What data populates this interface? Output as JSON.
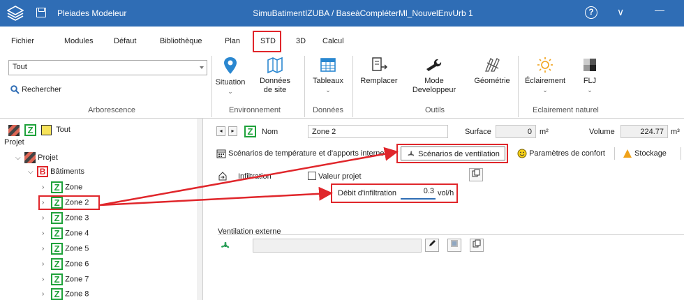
{
  "titlebar": {
    "app_name": "Pleiades Modeleur",
    "document": "SimuBatimentIZUBA / BaseàCompléterMl_NouvelEnvUrb 1",
    "help_symbol": "?",
    "chevron_symbol": "∨",
    "minimize_symbol": "—"
  },
  "menu": {
    "items": [
      "Fichier",
      "Modules",
      "Défaut",
      "Bibliothèque",
      "Plan",
      "STD",
      "3D",
      "Calcul"
    ]
  },
  "ribbon": {
    "combo_value": "Tout",
    "search_label": "Rechercher",
    "arborescence_label": "Arborescence",
    "buttons": {
      "situation": "Situation",
      "donnees_site": "Données\nde site",
      "tableaux": "Tableaux",
      "remplacer": "Remplacer",
      "mode_dev": "Mode\nDeveloppeur",
      "geometrie": "Géométrie",
      "eclairement": "Éclairement",
      "flj": "FLJ"
    },
    "groups": {
      "environnement": "Environnement",
      "donnees": "Données",
      "outils": "Outils",
      "eclairement_naturel": "Eclairement naturel"
    }
  },
  "tree": {
    "header_label": "Tout",
    "section_label": "Projet",
    "root": "Projet",
    "batiments_badge": "B",
    "batiments": "Bâtiments",
    "zone_badge": "Z",
    "zones": [
      "Zone",
      "Zone 2",
      "Zone 3",
      "Zone 4",
      "Zone 5",
      "Zone 6",
      "Zone 7",
      "Zone 8"
    ]
  },
  "detail": {
    "nom_label": "Nom",
    "nom_value": "Zone 2",
    "surface_label": "Surface",
    "surface_value": "0",
    "surface_unit": "m²",
    "volume_label": "Volume",
    "volume_value": "224.77",
    "volume_unit": "m³",
    "tabs": {
      "scenarios_temp": "Scénarios de température et d'apports interne",
      "scenarios_vent": "Scénarios de ventilation",
      "confort": "Paramètres de confort",
      "stockage": "Stockage"
    },
    "infiltration_label": "Infiltration",
    "valeur_projet_label": "Valeur projet",
    "debit_label": "Débit d'infiltration",
    "debit_value": "0.3",
    "debit_unit": "vol/h",
    "ventilation_externe_label": "Ventilation externe"
  },
  "colors": {
    "titlebar": "#2f6db5",
    "highlight": "#e0262b",
    "zone_green": "#1fa23b"
  }
}
